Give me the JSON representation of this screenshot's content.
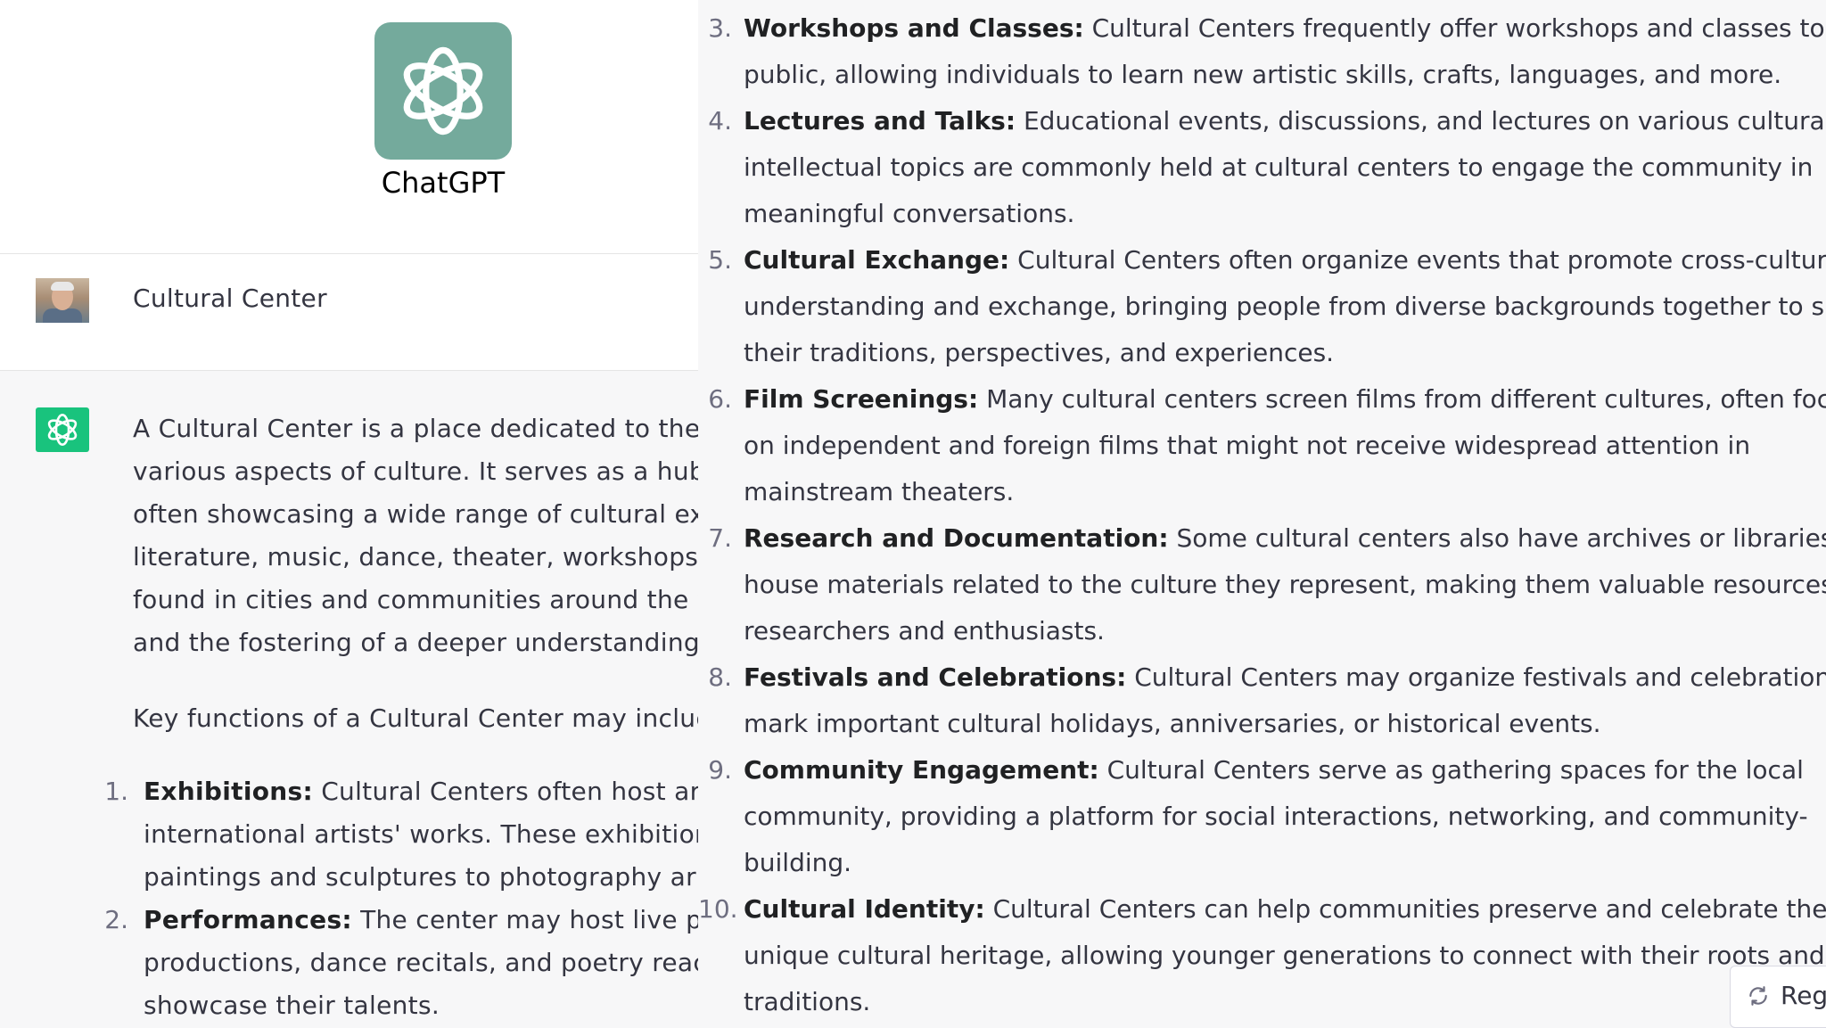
{
  "logo": {
    "name": "ChatGPT",
    "tile_color": "#74aa9c"
  },
  "user_message": "Cultural Center",
  "assistant": {
    "intro_lines": [
      "A Cultural Center is a place dedicated to the",
      "various aspects of culture. It serves as a hub",
      "often showcasing a wide range of cultural ex",
      "literature, music, dance, theater, workshops,",
      "found in cities and communities around the w",
      "and the fostering of a deeper understanding"
    ],
    "key_functions_line": "Key functions of a Cultural Center may incluc",
    "left_items": [
      {
        "num": "1.",
        "title": "Exhibitions:",
        "lines": [
          "Cultural Centers often host art e",
          "international artists' works. These exhibitior",
          "paintings and sculptures to photography ar"
        ]
      },
      {
        "num": "2.",
        "title": "Performances:",
        "lines": [
          "The center may host live per",
          "productions, dance recitals, and poetry reac",
          "showcase their talents."
        ]
      }
    ],
    "right_items": [
      {
        "num": "3.",
        "title": "Workshops and Classes:",
        "lines": [
          "Cultural Centers frequently offer workshops and classes to the",
          "public, allowing individuals to learn new artistic skills, crafts, languages, and more."
        ]
      },
      {
        "num": "4.",
        "title": "Lectures and Talks:",
        "lines": [
          "Educational events, discussions, and lectures on various cultural and",
          "intellectual topics are commonly held at cultural centers to engage the community in",
          "meaningful conversations."
        ]
      },
      {
        "num": "5.",
        "title": "Cultural Exchange:",
        "lines": [
          "Cultural Centers often organize events that promote cross-cultural",
          "understanding and exchange, bringing people from diverse backgrounds together to share",
          "their traditions, perspectives, and experiences."
        ]
      },
      {
        "num": "6.",
        "title": "Film Screenings:",
        "lines": [
          "Many cultural centers screen films from different cultures, often focusing",
          "on independent and foreign films that might not receive widespread attention in",
          "mainstream theaters."
        ]
      },
      {
        "num": "7.",
        "title": "Research and Documentation:",
        "lines": [
          "Some cultural centers also have archives or libraries that",
          "house materials related to the culture they represent, making them valuable resources for",
          "researchers and enthusiasts."
        ]
      },
      {
        "num": "8.",
        "title": "Festivals and Celebrations:",
        "lines": [
          "Cultural Centers may organize festivals and celebrations to",
          "mark important cultural holidays, anniversaries, or historical events."
        ]
      },
      {
        "num": "9.",
        "title": "Community Engagement:",
        "lines": [
          "Cultural Centers serve as gathering spaces for the local",
          "community, providing a platform for social interactions, networking, and community-",
          "building."
        ]
      },
      {
        "num": "10.",
        "title": "Cultural Identity:",
        "lines": [
          "Cultural Centers can help communities preserve and celebrate their",
          "unique cultural heritage, allowing younger generations to connect with their roots and",
          "traditions."
        ]
      }
    ]
  },
  "regenerate_label": "Reg",
  "colors": {
    "assistant_avatar": "#19c37d",
    "page_bg": "#f7f7f8",
    "text": "#343541"
  }
}
